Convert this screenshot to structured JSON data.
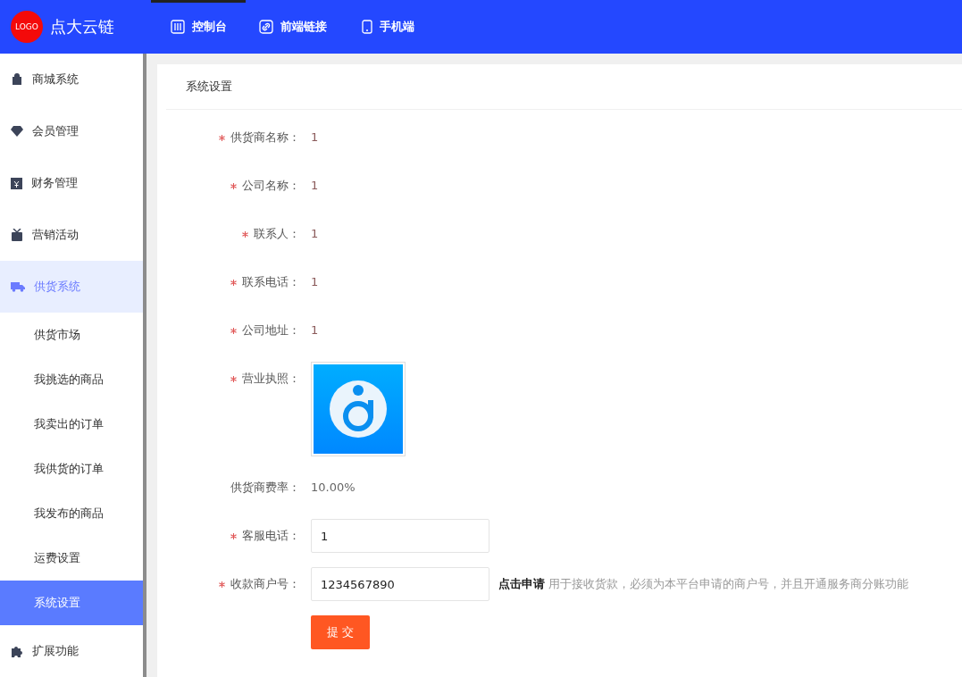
{
  "header": {
    "logo": "LOGO",
    "brand": "点大云链",
    "nav": [
      {
        "label": "控制台",
        "selected": true
      },
      {
        "label": "前端链接",
        "selected": false
      },
      {
        "label": "手机端",
        "selected": false
      }
    ]
  },
  "sidebar": {
    "items": [
      {
        "label": "商城系统",
        "expanded": false
      },
      {
        "label": "会员管理",
        "expanded": false
      },
      {
        "label": "财务管理",
        "expanded": false
      },
      {
        "label": "营销活动",
        "expanded": false
      },
      {
        "label": "供货系统",
        "expanded": true,
        "children": [
          {
            "label": "供货市场",
            "selected": false
          },
          {
            "label": "我挑选的商品",
            "selected": false
          },
          {
            "label": "我卖出的订单",
            "selected": false
          },
          {
            "label": "我供货的订单",
            "selected": false
          },
          {
            "label": "我发布的商品",
            "selected": false
          },
          {
            "label": "运费设置",
            "selected": false
          },
          {
            "label": "系统设置",
            "selected": true
          }
        ]
      },
      {
        "label": "扩展功能",
        "expanded": false
      }
    ]
  },
  "card": {
    "title": "系统设置",
    "fields": [
      {
        "kind": "text",
        "label": "供货商名称：",
        "required": true,
        "value": "1"
      },
      {
        "kind": "text",
        "label": "公司名称：",
        "required": true,
        "value": "1"
      },
      {
        "kind": "text",
        "label": "联系人：",
        "required": true,
        "value": "1"
      },
      {
        "kind": "text",
        "label": "联系电话：",
        "required": true,
        "value": "1"
      },
      {
        "kind": "text",
        "label": "公司地址：",
        "required": true,
        "value": "1"
      },
      {
        "kind": "image",
        "label": "营业执照：",
        "required": true
      },
      {
        "kind": "plain",
        "label": "供货商费率：",
        "required": false,
        "value": "10.00%"
      },
      {
        "kind": "input",
        "label": "客服电话：",
        "required": true,
        "value": "1"
      },
      {
        "kind": "input",
        "label": "收款商户号：",
        "required": true,
        "value": "1234567890",
        "link": "点击申请",
        "hint": "用于接收货款，必须为本平台申请的商户号，并且开通服务商分账功能"
      }
    ],
    "submit": "提 交"
  }
}
